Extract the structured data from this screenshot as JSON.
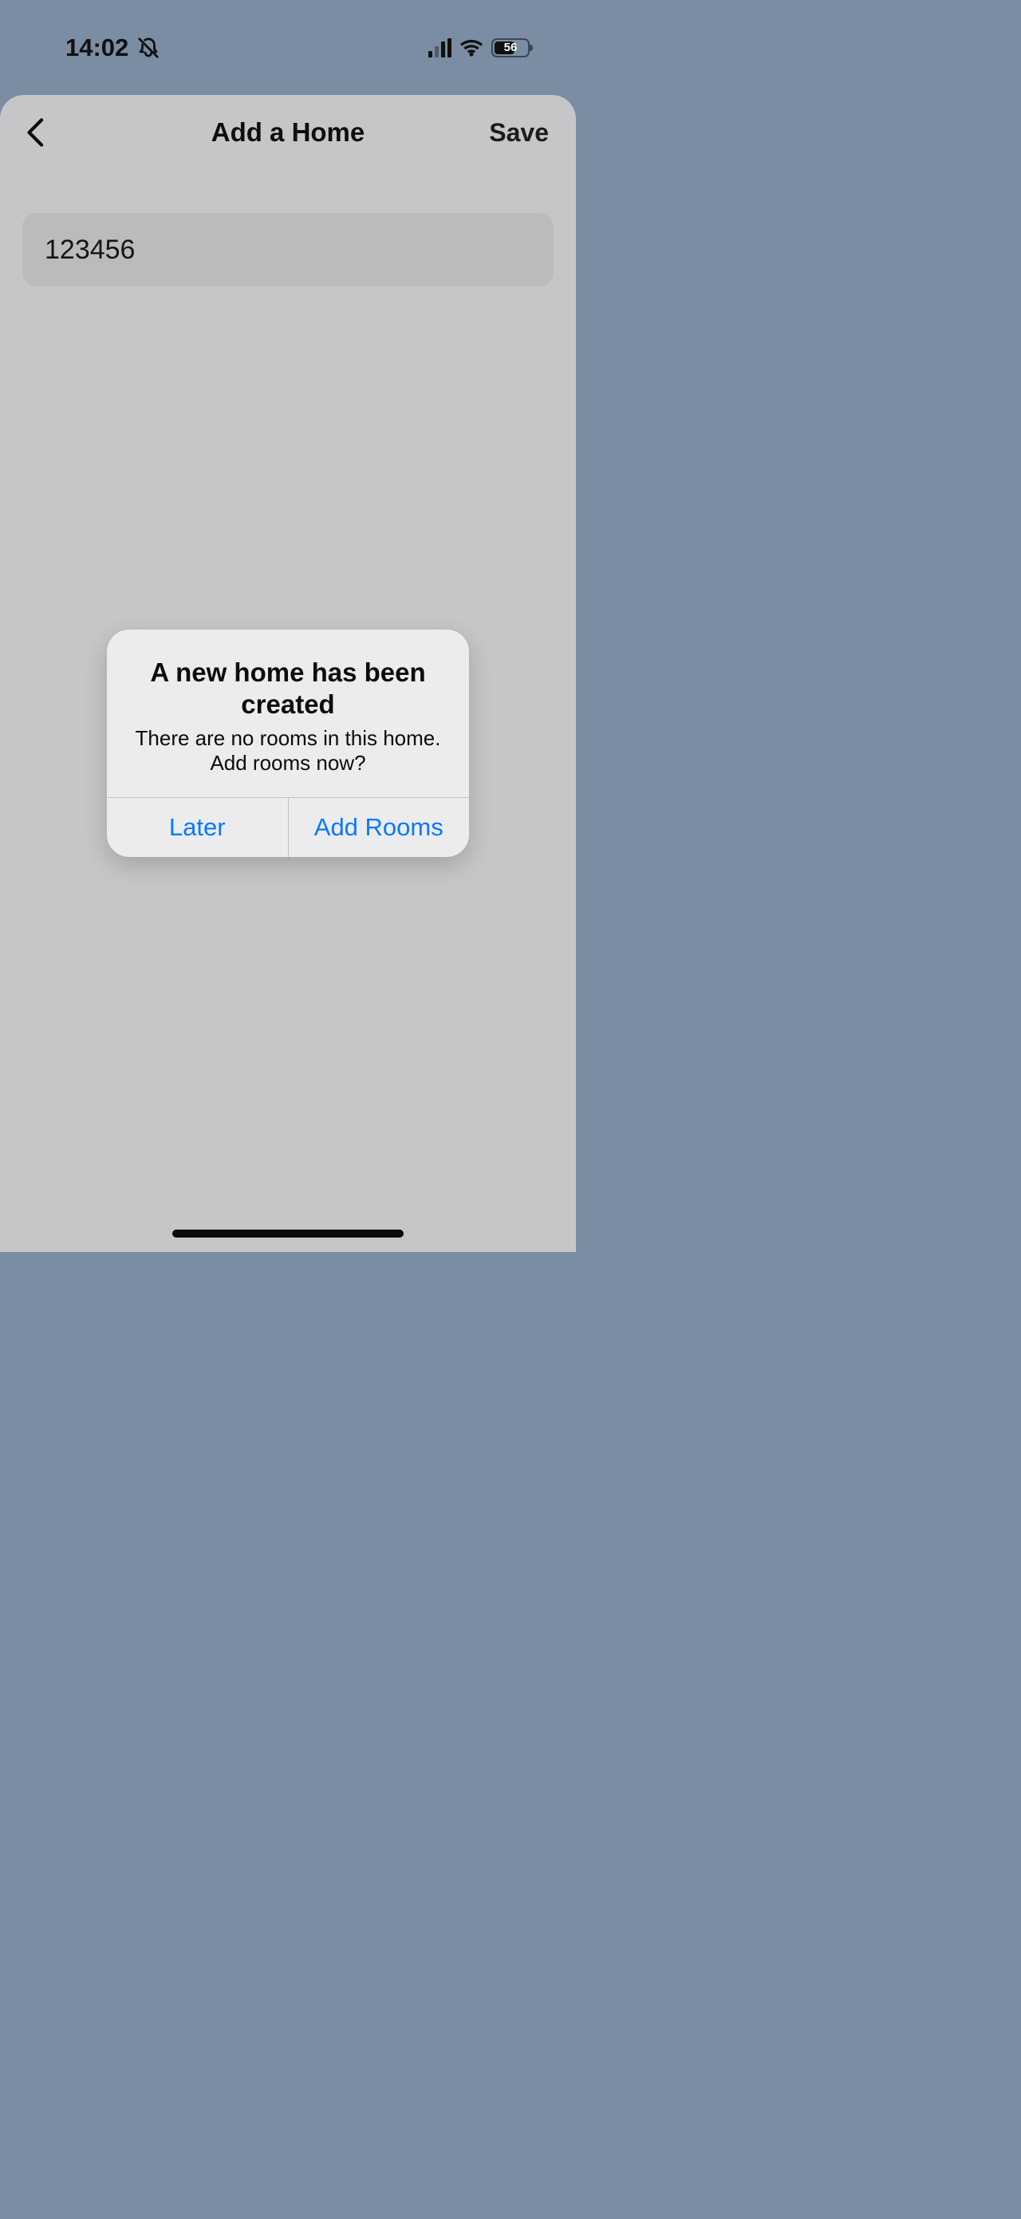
{
  "status_bar": {
    "time": "14:02",
    "battery_percent": "56"
  },
  "page": {
    "title": "Add a Home",
    "save_label": "Save",
    "home_name_value": "123456"
  },
  "alert": {
    "title": "A new home has been created",
    "message": "There are no rooms in this home. Add rooms now?",
    "later_label": "Later",
    "add_rooms_label": "Add Rooms"
  }
}
